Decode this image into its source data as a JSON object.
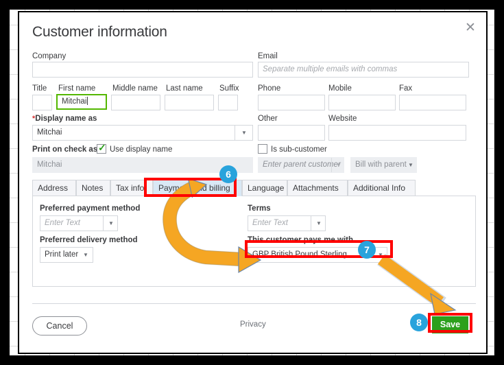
{
  "dialog": {
    "title": "Customer information",
    "close_icon": "close-icon"
  },
  "left_column": {
    "company": {
      "label": "Company",
      "value": ""
    },
    "name_row": [
      {
        "label": "Title",
        "value": ""
      },
      {
        "label": "First name",
        "value": "Mitchai"
      },
      {
        "label": "Middle name",
        "value": ""
      },
      {
        "label": "Last name",
        "value": ""
      },
      {
        "label": "Suffix",
        "value": ""
      }
    ],
    "display_name": {
      "label": "Display name as",
      "required_mark": "*",
      "value": "Mitchai"
    },
    "print_on_check": {
      "label": "Print on check as",
      "checkbox_label": "Use display name",
      "checked": true,
      "value": "Mitchai"
    }
  },
  "right_column": {
    "email": {
      "label": "Email",
      "placeholder": "Separate multiple emails with commas",
      "value": ""
    },
    "phone": {
      "label": "Phone",
      "value": ""
    },
    "mobile": {
      "label": "Mobile",
      "value": ""
    },
    "fax": {
      "label": "Fax",
      "value": ""
    },
    "other": {
      "label": "Other",
      "value": ""
    },
    "website": {
      "label": "Website",
      "value": ""
    },
    "sub_customer": {
      "checkbox_label": "Is sub-customer",
      "checked": false,
      "parent_placeholder": "Enter parent customer",
      "bill_option": "Bill with parent"
    }
  },
  "tabs": [
    {
      "label": "Address",
      "active": false
    },
    {
      "label": "Notes",
      "active": false
    },
    {
      "label": "Tax info",
      "active": false
    },
    {
      "label": "Payment and billing",
      "active": true
    },
    {
      "label": "Language",
      "active": false
    },
    {
      "label": "Attachments",
      "active": false
    },
    {
      "label": "Additional Info",
      "active": false
    }
  ],
  "payment_panel": {
    "preferred_payment_method": {
      "label": "Preferred payment method",
      "placeholder": "Enter Text",
      "value": ""
    },
    "preferred_delivery_method": {
      "label": "Preferred delivery method",
      "value": "Print later"
    },
    "terms": {
      "label": "Terms",
      "placeholder": "Enter Text",
      "value": ""
    },
    "currency": {
      "label": "This customer pays me with",
      "value": "GBP British Pound Sterling"
    }
  },
  "footer": {
    "cancel_label": "Cancel",
    "privacy_label": "Privacy",
    "save_label": "Save"
  },
  "annotations": {
    "step6": "6",
    "step7": "7",
    "step8": "8",
    "highlight_color": "#ff0000",
    "badge_color": "#29a3dc",
    "arrow_color": "#f5a623",
    "save_color": "#2ca01c"
  }
}
